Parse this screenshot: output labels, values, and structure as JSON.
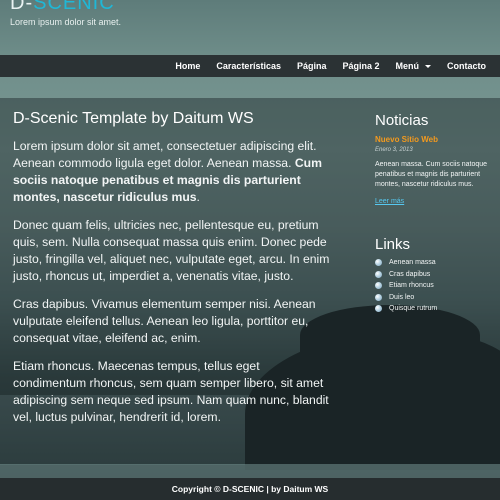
{
  "site": {
    "logo_prefix": "D-",
    "logo_accent": "SCENIC",
    "tagline": "Lorem ipsum dolor sit amet."
  },
  "nav": {
    "items": [
      "Home",
      "Características",
      "Página",
      "Página 2",
      "Menú",
      "Contacto"
    ]
  },
  "main": {
    "title": "D-Scenic Template by Daitum WS",
    "p1_text": "Lorem ipsum dolor sit amet, consectetuer adipiscing elit. Aenean commodo ligula eget dolor. Aenean massa. ",
    "p1_bold": "Cum sociis natoque penatibus et magnis dis parturient montes, nascetur ridiculus mus",
    "p1_end": ".",
    "p2": "Donec quam felis, ultricies nec, pellentesque eu, pretium quis, sem. Nulla consequat massa quis enim. Donec pede justo, fringilla vel, aliquet nec, vulputate eget, arcu. In enim justo, rhoncus ut, imperdiet a, venenatis vitae, justo.",
    "p3": "Cras dapibus. Vivamus elementum semper nisi. Aenean vulputate eleifend tellus. Aenean leo ligula, porttitor eu, consequat vitae, eleifend ac, enim.",
    "p4": "Etiam rhoncus. Maecenas tempus, tellus eget condimentum rhoncus, sem quam semper libero, sit amet adipiscing sem neque sed ipsum. Nam quam nunc, blandit vel, luctus pulvinar, hendrerit id, lorem."
  },
  "sidebar": {
    "news_heading": "Noticias",
    "news_title": "Nuevo Sitio Web",
    "news_date": "Enero 3, 2013",
    "news_text": "Aenean massa. Cum sociis natoque penatibus et magnis dis parturient montes, nascetur ridiculus mus.",
    "news_more": "Leer más",
    "links_heading": "Links",
    "links": [
      "Aenean massa",
      "Cras dapibus",
      "Etiam rhoncus",
      "Duis leo",
      "Quisque rutrum"
    ]
  },
  "footer": {
    "text": "Copyright © D-SCENIC | by Daitum WS"
  },
  "colors": {
    "accent_logo": "#20b7d6",
    "news_title": "#f39a1e",
    "link": "#56c8f0",
    "navbar": "#2b3234"
  }
}
